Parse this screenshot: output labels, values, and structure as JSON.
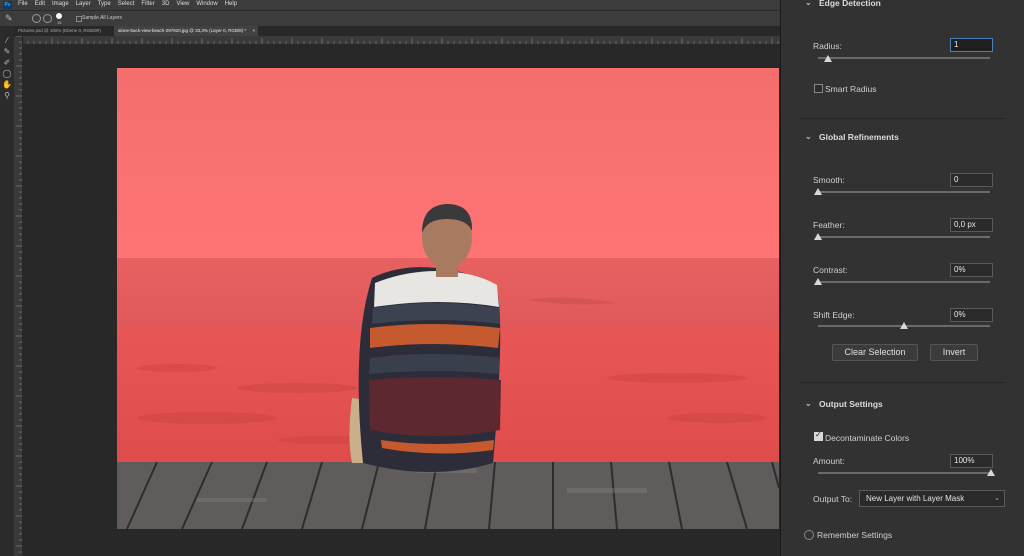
{
  "app": {
    "logo": "Ps"
  },
  "menu": [
    "File",
    "Edit",
    "Image",
    "Layer",
    "Type",
    "Select",
    "Filter",
    "3D",
    "View",
    "Window",
    "Help"
  ],
  "options_bar": {
    "brush_size": "15",
    "sample_all_layers": "Sample All Layers"
  },
  "tabs": [
    {
      "label": "Pictures.psd @ 100% (Ebene 0, RGB/8#)",
      "active": false
    },
    {
      "label": "alone-back-view-beach-297920.jpg @ 33,3% (Layer 0, RGB/8) *",
      "active": true
    }
  ],
  "panel": {
    "edge_detection": {
      "title": "Edge Detection",
      "radius_label": "Radius:",
      "radius_value": "1",
      "radius_level": 0.05,
      "smart_radius_label": "Smart Radius",
      "smart_radius_checked": false
    },
    "global_refinements": {
      "title": "Global Refinements",
      "smooth_label": "Smooth:",
      "smooth_value": "0",
      "feather_label": "Feather:",
      "feather_value": "0,0 px",
      "contrast_label": "Contrast:",
      "contrast_value": "0%",
      "shift_edge_label": "Shift Edge:",
      "shift_edge_value": "0%"
    },
    "buttons": {
      "clear_selection": "Clear Selection",
      "invert": "Invert"
    },
    "output_settings": {
      "title": "Output Settings",
      "decontaminate_label": "Decontaminate Colors",
      "decontaminate_checked": true,
      "amount_label": "Amount:",
      "amount_value": "100%",
      "output_to_label": "Output To:",
      "output_to_value": "New Layer with Layer Mask"
    },
    "remember_settings": "Remember Settings"
  },
  "colors": {
    "overlay": "#ff5a5a",
    "panel_bg": "#323232",
    "accent": "#31a8ff"
  }
}
